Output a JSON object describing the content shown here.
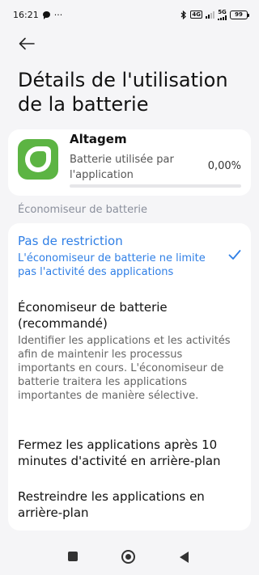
{
  "status_bar": {
    "time": "16:21",
    "more": "···",
    "network_tag": "4G",
    "network_5g": "5G",
    "battery": "99"
  },
  "header": {
    "back_icon": "arrow-left-icon",
    "title": "Détails de l'utilisation de la batterie"
  },
  "app": {
    "name": "Altagem",
    "usage_label": "Batterie utilisée par l'application",
    "usage_percent": "0,00%",
    "usage_fraction": 0,
    "icon_color": "#5cb443"
  },
  "section": {
    "label": "Économiseur de batterie"
  },
  "options": [
    {
      "title": "Pas de restriction",
      "description": "L'économiseur de batterie ne limite pas l'activité des applications",
      "selected": true
    },
    {
      "title": "Économiseur de batterie (recommandé)",
      "description": "Identifier les applications et les activités afin de maintenir les processus importants en cours. L'économiseur de batterie traitera les applications importantes de manière sélective.",
      "selected": false
    },
    {
      "title": "Fermez les applications après 10 minutes d'activité en arrière-plan",
      "selected": false
    },
    {
      "title": "Restreindre les applications en arrière-plan",
      "selected": false
    }
  ],
  "colors": {
    "accent": "#2f7fe6",
    "background": "#f5f5f7",
    "card": "#ffffff"
  }
}
